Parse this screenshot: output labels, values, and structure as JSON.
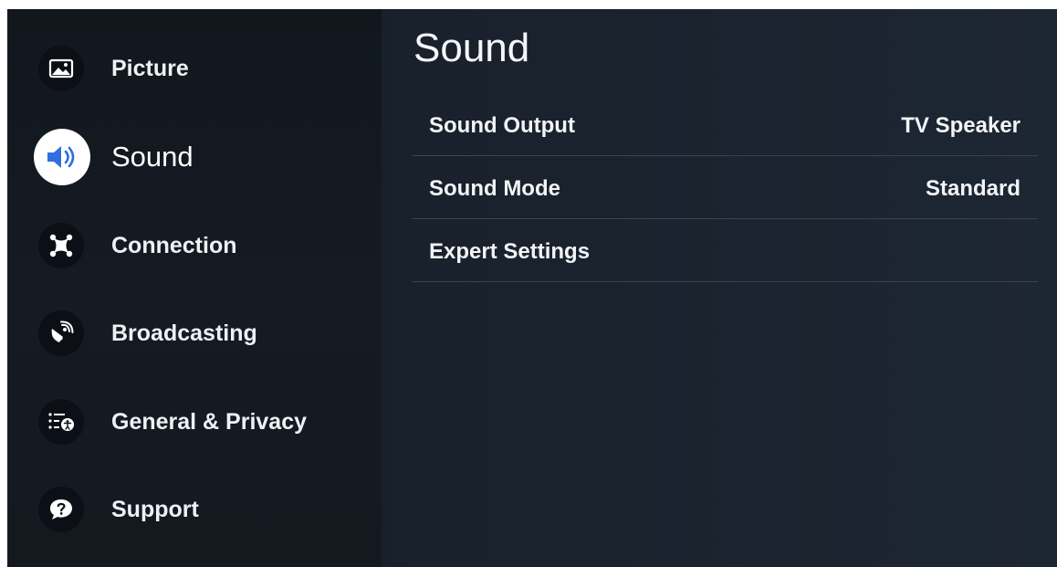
{
  "sidebar": {
    "items": [
      {
        "label": "Picture",
        "icon": "picture-icon"
      },
      {
        "label": "Sound",
        "icon": "speaker-icon",
        "selected": true
      },
      {
        "label": "Connection",
        "icon": "connection-icon"
      },
      {
        "label": "Broadcasting",
        "icon": "satellite-icon"
      },
      {
        "label": "General & Privacy",
        "icon": "general-privacy-icon"
      },
      {
        "label": "Support",
        "icon": "support-icon"
      }
    ]
  },
  "main": {
    "title": "Sound",
    "settings": [
      {
        "label": "Sound Output",
        "value": "TV Speaker"
      },
      {
        "label": "Sound Mode",
        "value": "Standard"
      },
      {
        "label": "Expert Settings",
        "value": ""
      }
    ]
  },
  "colors": {
    "background": "#19212c",
    "sidebar": "#141920",
    "accent": "#2f6fe0",
    "divider": "#3a4350"
  }
}
